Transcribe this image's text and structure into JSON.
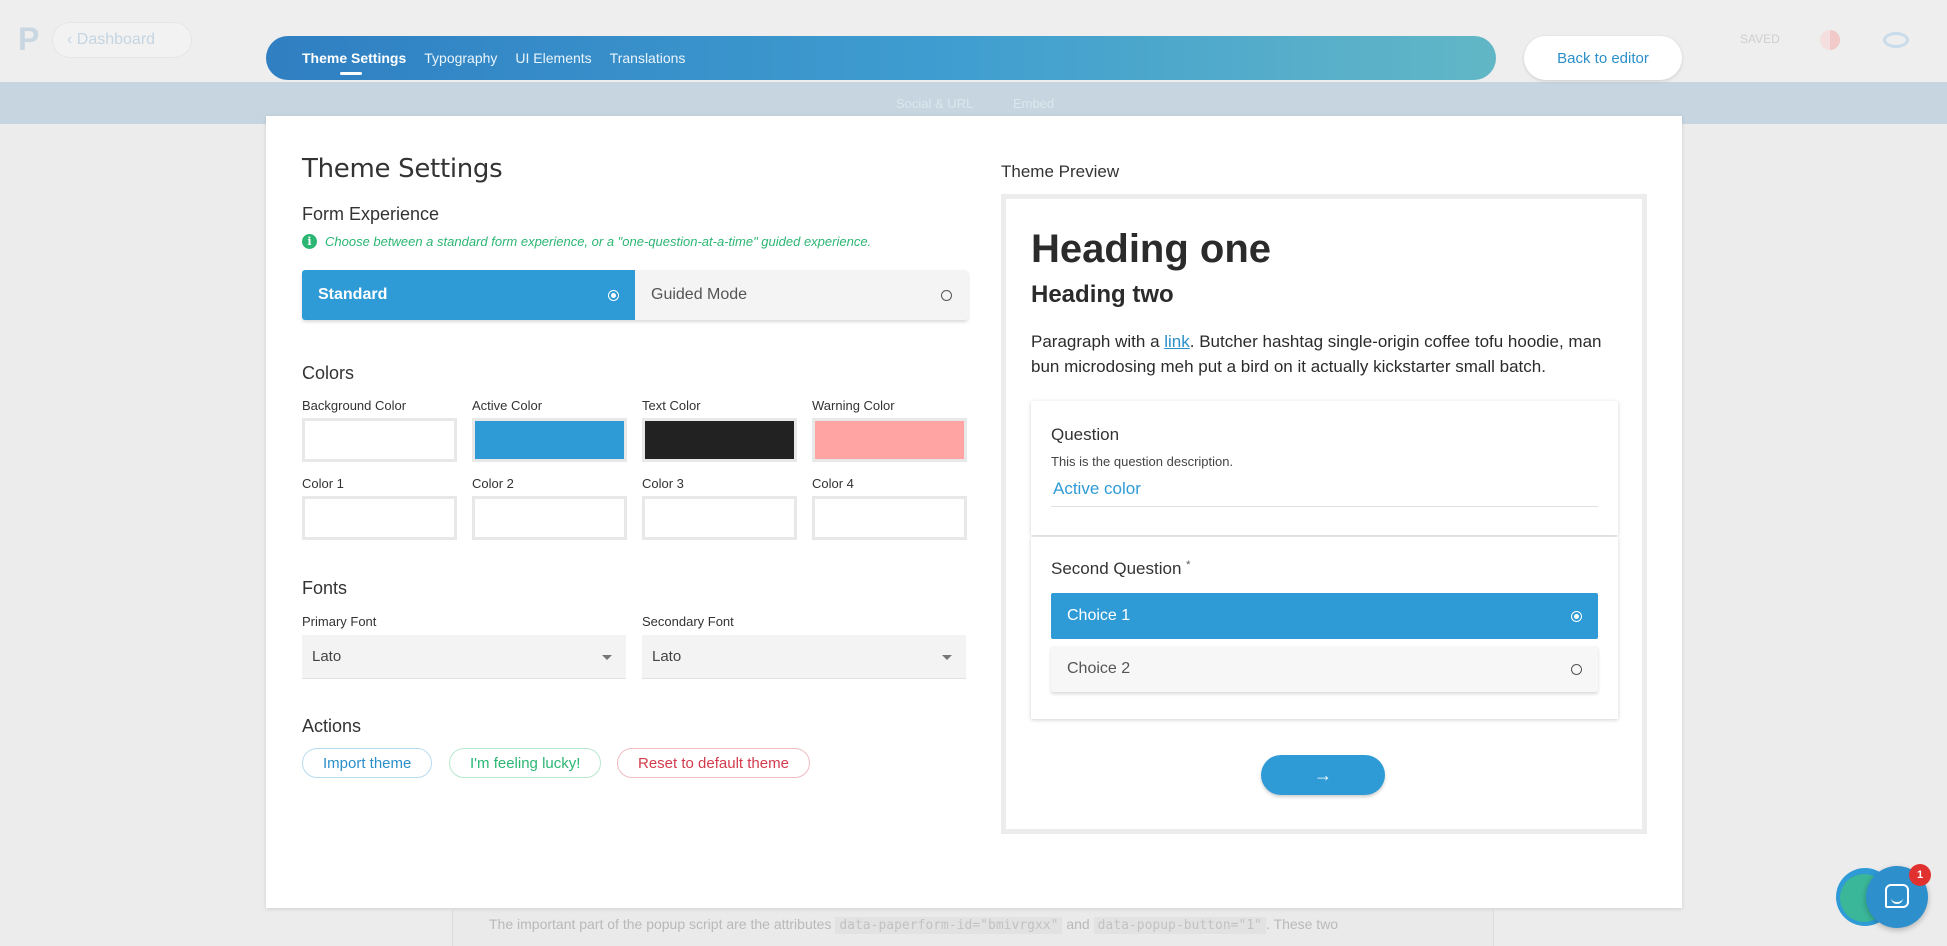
{
  "background": {
    "dashboard_label": "Dashboard",
    "saved_label": "SAVED",
    "tabs": [
      "Social & URL",
      "Embed"
    ],
    "bottom_text_before": "The important part of the popup script are the attributes",
    "bottom_code_1": "data-paperform-id=\"bmivrgxx\"",
    "bottom_text_middle": "and",
    "bottom_code_2": "data-popup-button=\"1\"",
    "bottom_text_after": ". These two"
  },
  "nav": {
    "tabs": [
      "Theme Settings",
      "Typography",
      "UI Elements",
      "Translations"
    ],
    "active_tab": "Theme Settings",
    "back_button": "Back to editor"
  },
  "settings": {
    "title": "Theme Settings",
    "form_experience": {
      "title": "Form Experience",
      "hint": "Choose between a standard form experience, or a \"one-question-at-a-time\" guided experience.",
      "options": [
        "Standard",
        "Guided Mode"
      ],
      "selected": "Standard"
    },
    "colors": {
      "title": "Colors",
      "swatches": [
        {
          "label": "Background Color",
          "color": "#ffffff"
        },
        {
          "label": "Active Color",
          "color": "#2e9bd6"
        },
        {
          "label": "Text Color",
          "color": "#222222"
        },
        {
          "label": "Warning Color",
          "color": "#ffa3a3"
        },
        {
          "label": "Color 1",
          "color": "#ffffff"
        },
        {
          "label": "Color 2",
          "color": "#ffffff"
        },
        {
          "label": "Color 3",
          "color": "#ffffff"
        },
        {
          "label": "Color 4",
          "color": "#ffffff"
        }
      ]
    },
    "fonts": {
      "title": "Fonts",
      "primary_label": "Primary Font",
      "primary_value": "Lato",
      "secondary_label": "Secondary Font",
      "secondary_value": "Lato"
    },
    "actions": {
      "title": "Actions",
      "import": "Import theme",
      "lucky": "I'm feeling lucky!",
      "reset": "Reset to default theme"
    }
  },
  "preview": {
    "title": "Theme Preview",
    "heading_one": "Heading one",
    "heading_two": "Heading two",
    "paragraph_before": "Paragraph with a ",
    "paragraph_link": "link",
    "paragraph_after": ". Butcher hashtag single-origin coffee tofu hoodie, man bun microdosing meh put a bird on it actually kickstarter small batch.",
    "question1": {
      "title": "Question",
      "description": "This is the question description.",
      "value": "Active color"
    },
    "question2": {
      "title": "Second Question",
      "required_mark": "*",
      "choices": [
        "Choice 1",
        "Choice 2"
      ],
      "selected": "Choice 1"
    },
    "prev_icon": "arrow-left-icon",
    "next_icon": "arrow-right-icon"
  },
  "chat": {
    "icon": "chat-icon",
    "badge": "1"
  }
}
